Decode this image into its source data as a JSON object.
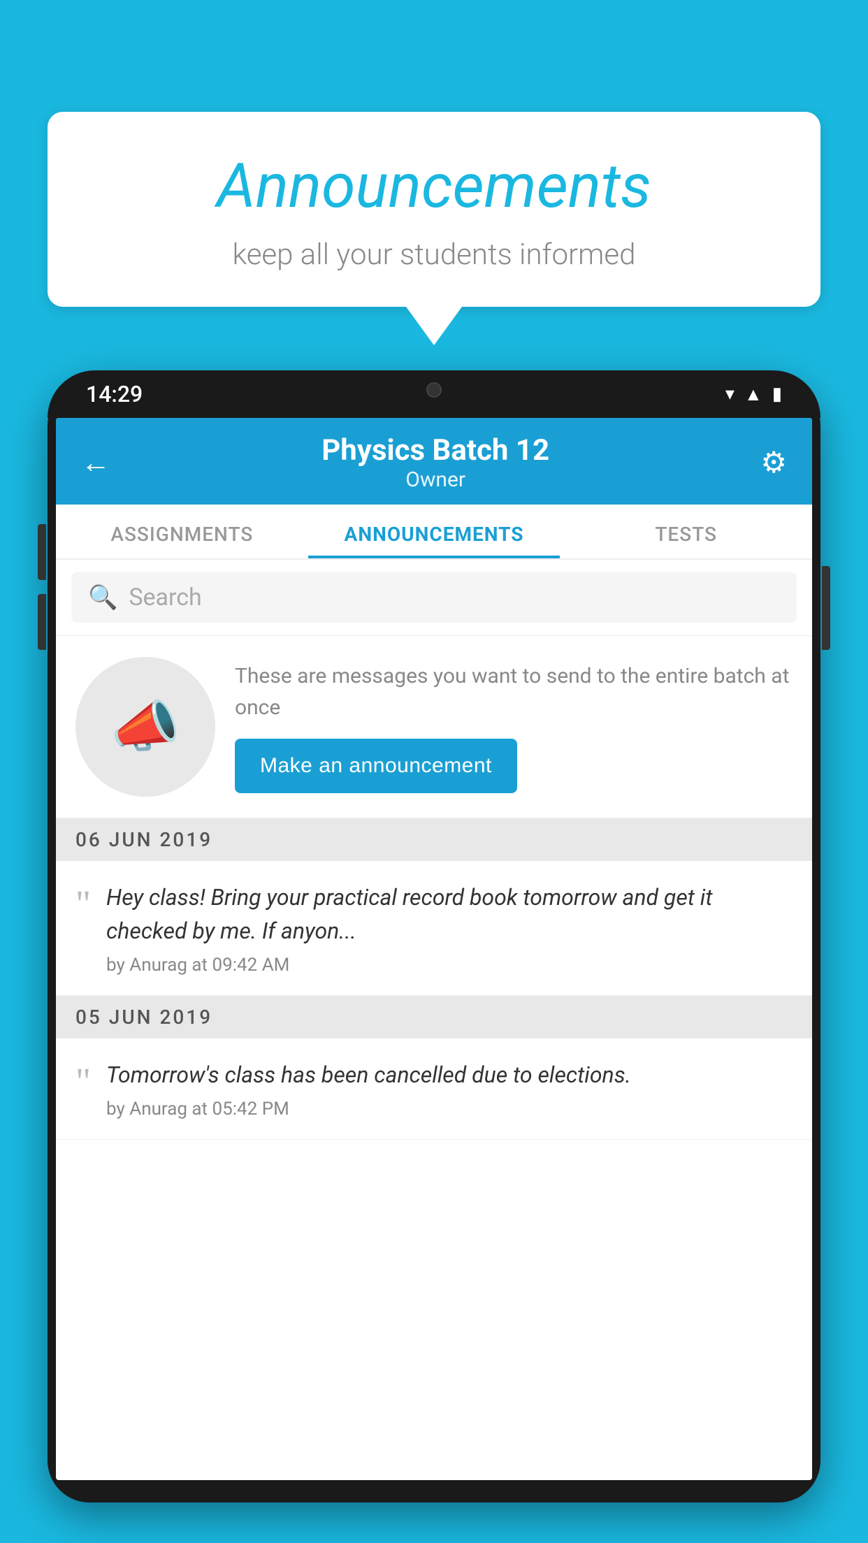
{
  "header": {
    "title": "Announcements",
    "subtitle": "keep all your students informed"
  },
  "phone": {
    "time": "14:29",
    "app_header": {
      "title": "Physics Batch 12",
      "subtitle": "Owner"
    },
    "tabs": [
      {
        "label": "ASSIGNMENTS",
        "active": false
      },
      {
        "label": "ANNOUNCEMENTS",
        "active": true
      },
      {
        "label": "TESTS",
        "active": false
      }
    ],
    "search": {
      "placeholder": "Search"
    },
    "promo": {
      "description": "These are messages you want to send to the entire batch at once",
      "button_label": "Make an announcement"
    },
    "announcements": [
      {
        "date": "06  JUN  2019",
        "text": "Hey class! Bring your practical record book tomorrow and get it checked by me. If anyon...",
        "meta": "by Anurag at 09:42 AM"
      },
      {
        "date": "05  JUN  2019",
        "text": "Tomorrow's class has been cancelled due to elections.",
        "meta": "by Anurag at 05:42 PM"
      }
    ]
  }
}
